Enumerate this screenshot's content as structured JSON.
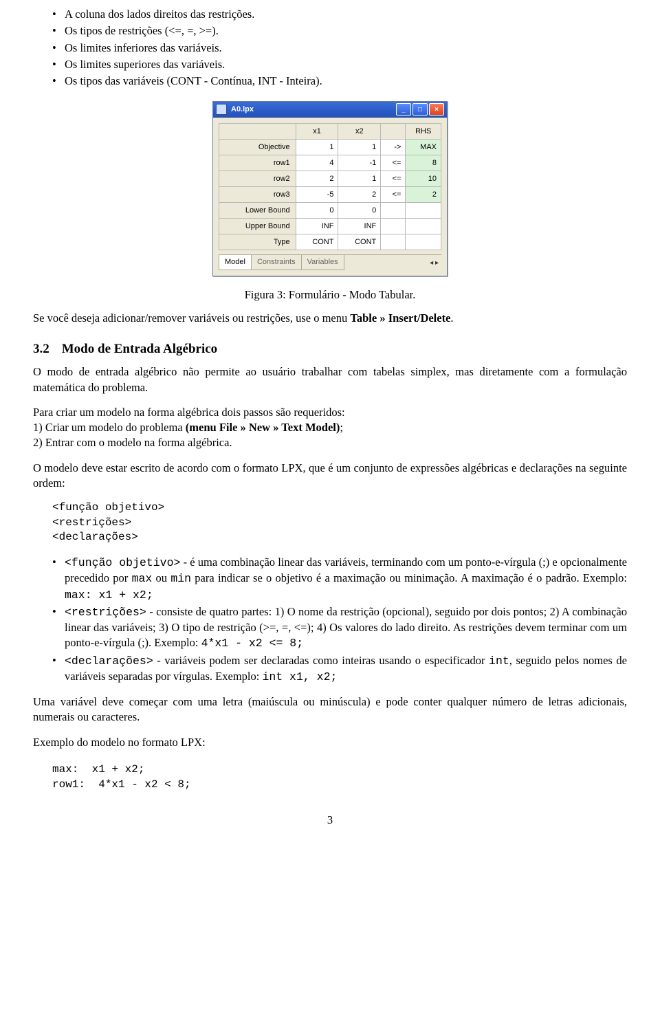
{
  "bullets_top": [
    "A coluna dos lados direitos das restrições.",
    "Os tipos de restrições (<=, =, >=).",
    "Os limites inferiores das variáveis.",
    "Os limites superiores das variáveis.",
    "Os tipos das variáveis (CONT - Contínua, INT - Inteira)."
  ],
  "window": {
    "title": "A0.lpx",
    "btn_min": "_",
    "btn_max": "□",
    "btn_close": "×",
    "cols": [
      "",
      "x1",
      "x2",
      "",
      "RHS"
    ],
    "rows": [
      [
        "Objective",
        "1",
        "1",
        "->",
        "MAX"
      ],
      [
        "row1",
        "4",
        "-1",
        "<=",
        "8"
      ],
      [
        "row2",
        "2",
        "1",
        "<=",
        "10"
      ],
      [
        "row3",
        "-5",
        "2",
        "<=",
        "2"
      ],
      [
        "Lower Bound",
        "0",
        "0",
        "",
        ""
      ],
      [
        "Upper Bound",
        "INF",
        "INF",
        "",
        ""
      ],
      [
        "Type",
        "CONT",
        "CONT",
        "",
        ""
      ]
    ],
    "tabs": [
      "Model",
      "Constraints",
      "Variables"
    ],
    "nav": "◂ ▸"
  },
  "fig_caption": "Figura 3: Formulário - Modo Tabular.",
  "p_after_fig_a": "Se você deseja adicionar/remover variáveis ou restrições, use o menu ",
  "p_after_fig_b": "Table » Insert/Delete",
  "p_after_fig_c": ".",
  "sec": {
    "num": "3.2",
    "title": "Modo de Entrada Algébrico"
  },
  "p_intro": "O modo de entrada algébrico não permite ao usuário trabalhar com tabelas simplex, mas diretamente com a formulação matemática do problema.",
  "p_steps_lead": "Para criar um modelo na forma algébrica dois passos são requeridos:",
  "p_step1_a": "1) Criar um modelo do problema ",
  "p_step1_b": "(menu File » New » Text Model)",
  "p_step1_c": ";",
  "p_step2": "2) Entrar com o modelo na forma algébrica.",
  "p_format": "O modelo deve estar escrito de acordo com o formato LPX, que é um conjunto de expressões algébricas e declarações na seguinte ordem:",
  "code_top": "<função objetivo>\n<restrições>\n<declarações>",
  "defs": {
    "obj_tag": "<função objetivo>",
    "obj_body_a": " - é uma combinação linear das variáveis, terminando com um ponto-e-vírgula (;) e opcionalmente precedido por ",
    "obj_max": "max",
    "obj_body_b": " ou ",
    "obj_min": "min",
    "obj_body_c": " para indicar se o objetivo é a maximação ou minimação. A maximação é o padrão. Exemplo: ",
    "obj_ex": "max:  x1 + x2;",
    "rest_tag": "<restrições>",
    "rest_body_a": " - consiste de quatro partes: 1) O nome da restrição (opcional), seguido por dois pontos; 2) A combinação linear das variáveis; 3) O tipo de restrição (>=, =, <=); 4) Os valores do lado direito. As restrições devem terminar com um ponto-e-vírgula (;). Exemplo: ",
    "rest_ex": "4*x1 - x2 <= 8;",
    "decl_tag": "<declarações>",
    "decl_body_a": " - variáveis podem ser declaradas como inteiras usando o especificador ",
    "decl_int": "int",
    "decl_body_b": ", seguido pelos nomes de variáveis separadas por vírgulas. Exemplo: ",
    "decl_ex": "int x1, x2;"
  },
  "p_var": "Uma variável deve começar com uma letra (maiúscula ou minúscula) e pode conter qualquer número de letras adicionais, numerais ou caracteres.",
  "p_ex_lead": "Exemplo do modelo no formato LPX:",
  "code_bottom": "max:  x1 + x2;\nrow1:  4*x1 - x2 < 8;",
  "pagenum": "3"
}
